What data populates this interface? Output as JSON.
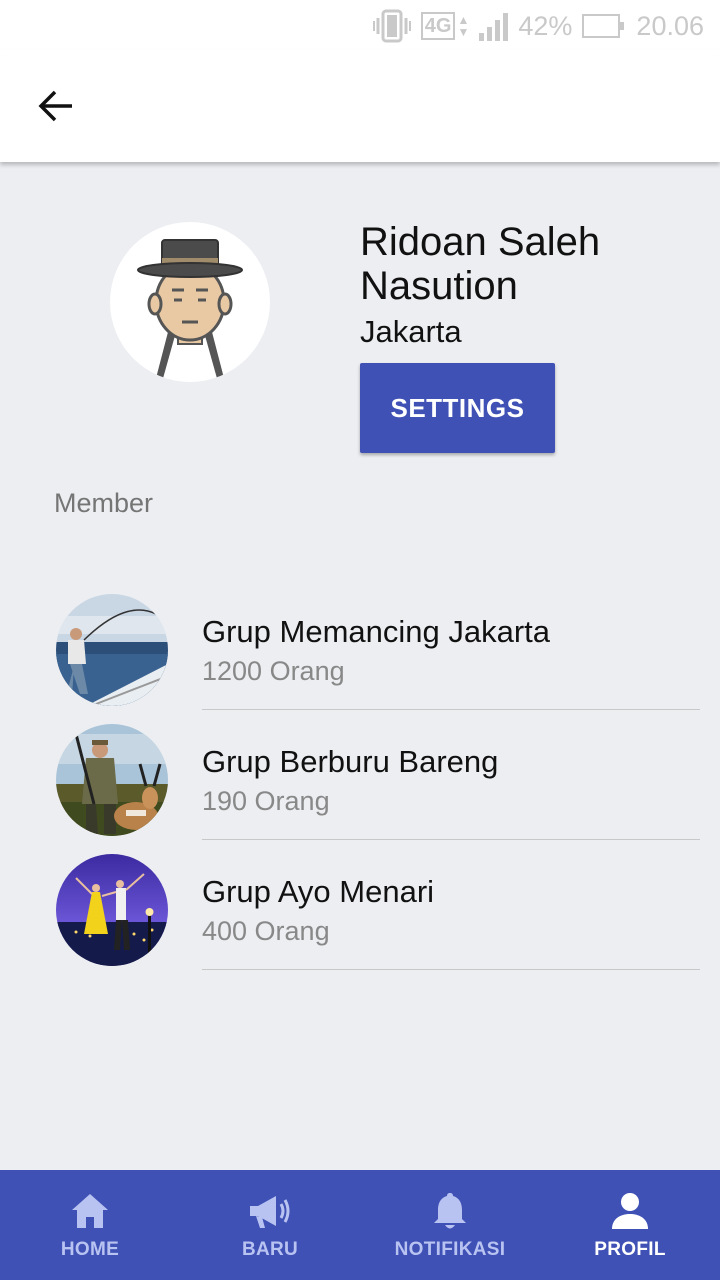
{
  "status_bar": {
    "network": "4G",
    "battery": "42%",
    "time": "20.06",
    "icons": [
      "vibrate-icon",
      "network-4g-icon",
      "signal-icon",
      "battery-icon"
    ]
  },
  "app_bar": {
    "back_icon": "arrow-back-icon"
  },
  "profile": {
    "name": "Ridoan Saleh Nasution",
    "city": "Jakarta",
    "settings_label": "SETTINGS"
  },
  "member_section_label": "Member",
  "groups": [
    {
      "title": "Grup Memancing Jakarta",
      "count": "1200 Orang"
    },
    {
      "title": "Grup Berburu Bareng",
      "count": "190 Orang"
    },
    {
      "title": "Grup Ayo Menari",
      "count": "400 Orang"
    }
  ],
  "bottom_nav": [
    {
      "label": "HOME",
      "icon": "home-icon",
      "active": false
    },
    {
      "label": "BARU",
      "icon": "megaphone-icon",
      "active": false
    },
    {
      "label": "NOTIFIKASI",
      "icon": "bell-icon",
      "active": false
    },
    {
      "label": "PROFIL",
      "icon": "person-icon",
      "active": true
    }
  ],
  "colors": {
    "primary": "#3f51b5",
    "background": "#eceef2",
    "nav_inactive": "#b9c3f2",
    "nav_active": "#ffffff"
  }
}
